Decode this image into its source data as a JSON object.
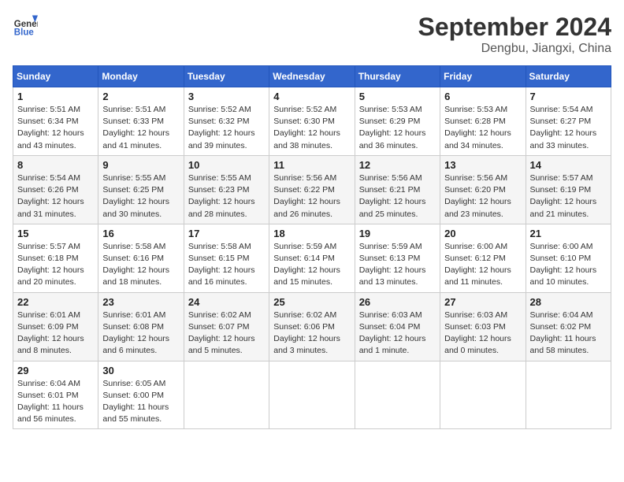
{
  "header": {
    "logo_line1": "General",
    "logo_line2": "Blue",
    "month": "September 2024",
    "location": "Dengbu, Jiangxi, China"
  },
  "weekdays": [
    "Sunday",
    "Monday",
    "Tuesday",
    "Wednesday",
    "Thursday",
    "Friday",
    "Saturday"
  ],
  "weeks": [
    [
      {
        "day": "1",
        "info": "Sunrise: 5:51 AM\nSunset: 6:34 PM\nDaylight: 12 hours\nand 43 minutes."
      },
      {
        "day": "2",
        "info": "Sunrise: 5:51 AM\nSunset: 6:33 PM\nDaylight: 12 hours\nand 41 minutes."
      },
      {
        "day": "3",
        "info": "Sunrise: 5:52 AM\nSunset: 6:32 PM\nDaylight: 12 hours\nand 39 minutes."
      },
      {
        "day": "4",
        "info": "Sunrise: 5:52 AM\nSunset: 6:30 PM\nDaylight: 12 hours\nand 38 minutes."
      },
      {
        "day": "5",
        "info": "Sunrise: 5:53 AM\nSunset: 6:29 PM\nDaylight: 12 hours\nand 36 minutes."
      },
      {
        "day": "6",
        "info": "Sunrise: 5:53 AM\nSunset: 6:28 PM\nDaylight: 12 hours\nand 34 minutes."
      },
      {
        "day": "7",
        "info": "Sunrise: 5:54 AM\nSunset: 6:27 PM\nDaylight: 12 hours\nand 33 minutes."
      }
    ],
    [
      {
        "day": "8",
        "info": "Sunrise: 5:54 AM\nSunset: 6:26 PM\nDaylight: 12 hours\nand 31 minutes."
      },
      {
        "day": "9",
        "info": "Sunrise: 5:55 AM\nSunset: 6:25 PM\nDaylight: 12 hours\nand 30 minutes."
      },
      {
        "day": "10",
        "info": "Sunrise: 5:55 AM\nSunset: 6:23 PM\nDaylight: 12 hours\nand 28 minutes."
      },
      {
        "day": "11",
        "info": "Sunrise: 5:56 AM\nSunset: 6:22 PM\nDaylight: 12 hours\nand 26 minutes."
      },
      {
        "day": "12",
        "info": "Sunrise: 5:56 AM\nSunset: 6:21 PM\nDaylight: 12 hours\nand 25 minutes."
      },
      {
        "day": "13",
        "info": "Sunrise: 5:56 AM\nSunset: 6:20 PM\nDaylight: 12 hours\nand 23 minutes."
      },
      {
        "day": "14",
        "info": "Sunrise: 5:57 AM\nSunset: 6:19 PM\nDaylight: 12 hours\nand 21 minutes."
      }
    ],
    [
      {
        "day": "15",
        "info": "Sunrise: 5:57 AM\nSunset: 6:18 PM\nDaylight: 12 hours\nand 20 minutes."
      },
      {
        "day": "16",
        "info": "Sunrise: 5:58 AM\nSunset: 6:16 PM\nDaylight: 12 hours\nand 18 minutes."
      },
      {
        "day": "17",
        "info": "Sunrise: 5:58 AM\nSunset: 6:15 PM\nDaylight: 12 hours\nand 16 minutes."
      },
      {
        "day": "18",
        "info": "Sunrise: 5:59 AM\nSunset: 6:14 PM\nDaylight: 12 hours\nand 15 minutes."
      },
      {
        "day": "19",
        "info": "Sunrise: 5:59 AM\nSunset: 6:13 PM\nDaylight: 12 hours\nand 13 minutes."
      },
      {
        "day": "20",
        "info": "Sunrise: 6:00 AM\nSunset: 6:12 PM\nDaylight: 12 hours\nand 11 minutes."
      },
      {
        "day": "21",
        "info": "Sunrise: 6:00 AM\nSunset: 6:10 PM\nDaylight: 12 hours\nand 10 minutes."
      }
    ],
    [
      {
        "day": "22",
        "info": "Sunrise: 6:01 AM\nSunset: 6:09 PM\nDaylight: 12 hours\nand 8 minutes."
      },
      {
        "day": "23",
        "info": "Sunrise: 6:01 AM\nSunset: 6:08 PM\nDaylight: 12 hours\nand 6 minutes."
      },
      {
        "day": "24",
        "info": "Sunrise: 6:02 AM\nSunset: 6:07 PM\nDaylight: 12 hours\nand 5 minutes."
      },
      {
        "day": "25",
        "info": "Sunrise: 6:02 AM\nSunset: 6:06 PM\nDaylight: 12 hours\nand 3 minutes."
      },
      {
        "day": "26",
        "info": "Sunrise: 6:03 AM\nSunset: 6:04 PM\nDaylight: 12 hours\nand 1 minute."
      },
      {
        "day": "27",
        "info": "Sunrise: 6:03 AM\nSunset: 6:03 PM\nDaylight: 12 hours\nand 0 minutes."
      },
      {
        "day": "28",
        "info": "Sunrise: 6:04 AM\nSunset: 6:02 PM\nDaylight: 11 hours\nand 58 minutes."
      }
    ],
    [
      {
        "day": "29",
        "info": "Sunrise: 6:04 AM\nSunset: 6:01 PM\nDaylight: 11 hours\nand 56 minutes."
      },
      {
        "day": "30",
        "info": "Sunrise: 6:05 AM\nSunset: 6:00 PM\nDaylight: 11 hours\nand 55 minutes."
      },
      {
        "day": "",
        "info": ""
      },
      {
        "day": "",
        "info": ""
      },
      {
        "day": "",
        "info": ""
      },
      {
        "day": "",
        "info": ""
      },
      {
        "day": "",
        "info": ""
      }
    ]
  ]
}
